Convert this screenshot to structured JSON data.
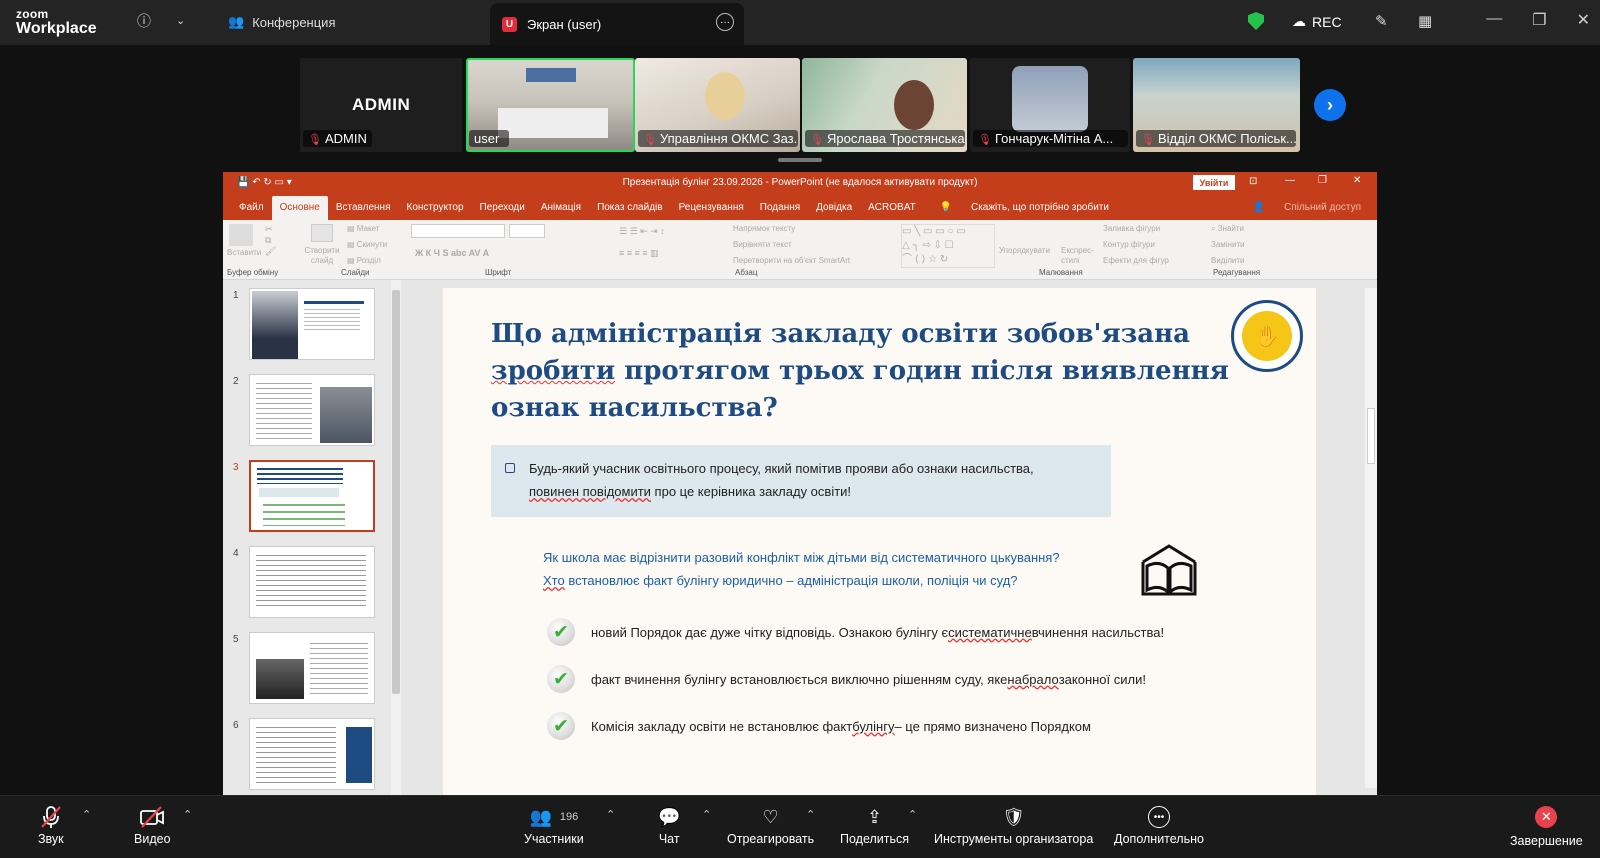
{
  "zoom": {
    "logo_line1": "zoom",
    "logo_line2": "Workplace",
    "meeting_label": "Конференция",
    "screen_tab": "Экран (user)",
    "rec": "REC",
    "participants_count": "196",
    "accent": "#0e72ed"
  },
  "participants": [
    {
      "name": "ADMIN",
      "tile_label": "ADMIN"
    },
    {
      "name": "user"
    },
    {
      "name": "Управління ОКМС Заз..."
    },
    {
      "name": "Ярослава Тростянська"
    },
    {
      "name": "Гончарук-Мітіна А..."
    },
    {
      "name": "Відділ ОКМС Поліськ..."
    }
  ],
  "ppt": {
    "window_title": "Презентація булінг 23.09.2026  -  PowerPoint (не вдалося активувати продукт)",
    "signin": "Увійти",
    "tabs": [
      "Файл",
      "Основне",
      "Вставлення",
      "Конструктор",
      "Переходи",
      "Анімація",
      "Показ слайдів",
      "Рецензування",
      "Подання",
      "Довідка",
      "ACROBAT"
    ],
    "tellme": "Скажіть, що потрібно зробити",
    "share": "Спільний доступ",
    "ribbon_groups": [
      "Буфер обміну",
      "Слайди",
      "Шрифт",
      "Абзац",
      "Малювання",
      "Редагування"
    ],
    "ribbon_buttons": {
      "paste": "Вставити",
      "new_slide": "Створити слайд",
      "layout": "Макет",
      "reset": "Скинути",
      "section": "Розділ",
      "text_direction": "Напрямок тексту",
      "align_text": "Вирівняти текст",
      "smartart": "Перетворити на об'єкт SmartArt",
      "arrange": "Упорядкувати",
      "quick_styles": "Експрес-стилі",
      "shape_fill": "Заливка фігури",
      "shape_outline": "Контур фігури",
      "shape_effects": "Ефекти для фігур",
      "find": "Знайти",
      "replace": "Замінити",
      "select": "Виділити"
    },
    "slide_numbers": [
      "1",
      "2",
      "3",
      "4",
      "5",
      "6"
    ],
    "selected_slide": 3
  },
  "slide": {
    "title_l1": "Що адміністрація закладу освіти зобов'язана",
    "title_l2a": "зробити",
    "title_l2b": " протягом трьох годин після виявлення",
    "title_l3": "ознак насильства?",
    "callout_l1": "Будь-який учасник освітнього процесу, який помітив прояви або ознаки насильства,",
    "callout_l2a": "повинен повідомити",
    "callout_l2b": " про це керівника закладу освіти!",
    "q1": "Як школа має відрізнити разовий конфлікт між дітьми від систематичного цькування?",
    "q2a": "Хто",
    "q2b": " встановлює факт булінгу юридично – адміністрація школи, поліція чи суд?",
    "b1a": "новий Порядок дає дуже чітку відповідь. Ознакою булінгу є ",
    "b1b": "систематичне",
    "b1c": " вчинення насильства!",
    "b2a": "факт вчинення булінгу встановлюється виключно рішенням суду, яке ",
    "b2b": "набрало",
    "b2c": " законної сили!",
    "b3a": "Комісія закладу освіти не встановлює факт ",
    "b3b": "булінгу",
    "b3c": " – це прямо визначено Порядком"
  },
  "toolbar": {
    "audio": "Звук",
    "video": "Видео",
    "participants": "Участники",
    "chat": "Чат",
    "react": "Отреагировать",
    "share": "Поделиться",
    "host_tools": "Инструменты организатора",
    "more": "Дополнительно",
    "end": "Завершение"
  }
}
